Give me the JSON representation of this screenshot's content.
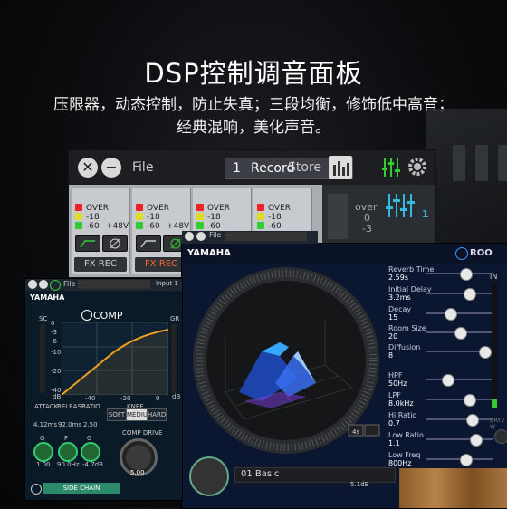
{
  "headline": {
    "title": "DSP控制调音面板",
    "line1": "压限器，动态控制，防止失真；三段均衡，修饰低中高音；",
    "line2": "经典混响，美化声音。"
  },
  "main_window": {
    "file_label": "File",
    "preset_number": "1",
    "preset_name": "Record",
    "store_label": "Store",
    "channels": [
      {
        "over": "OVER",
        "l1": "-18",
        "l2": "-60",
        "phantom": "+48V",
        "fx": "FX REC",
        "fx_active": false
      },
      {
        "over": "OVER",
        "l1": "-18",
        "l2": "-60",
        "phantom": "+48V",
        "fx": "FX REC",
        "fx_active": true
      },
      {
        "over": "OVER",
        "l1": "-18",
        "l2": "-60"
      },
      {
        "over": "OVER",
        "l1": "-18",
        "l2": "-60"
      }
    ],
    "output": {
      "over": "over",
      "zero": "0",
      "minus": "-3",
      "one": "1"
    }
  },
  "reverb_window": {
    "logo": "YAMAHA",
    "brand": "ROO",
    "small_file": "File",
    "small_preset": "---",
    "time_readout": "4s",
    "in_label": "IN",
    "dry_label": "DRY / W",
    "params": [
      {
        "label": "Reverb Time",
        "value": "2.59s",
        "pos": 0.55
      },
      {
        "label": "Initial Delay",
        "value": "3.2ms",
        "pos": 0.6
      },
      {
        "label": "Decay",
        "value": "15",
        "pos": 0.3
      },
      {
        "label": "Room Size",
        "value": "20",
        "pos": 0.45
      },
      {
        "label": "Diffusion",
        "value": "8",
        "pos": 0.85
      },
      {
        "label": "HPF",
        "value": "50Hz",
        "pos": 0.25
      },
      {
        "label": "LPF",
        "value": "8.0kHz",
        "pos": 0.6
      },
      {
        "label": "Hi Ratio",
        "value": "0.7",
        "pos": 0.65
      },
      {
        "label": "Low Ratio",
        "value": "1.1",
        "pos": 0.7
      },
      {
        "label": "Low Freq",
        "value": "800Hz",
        "pos": 0.55
      }
    ],
    "bottom_preset": "01 Basic",
    "small_value": "5.1dB"
  },
  "comp_window": {
    "file_label": "File",
    "preset": "---",
    "input": "Input 1",
    "logo": "YAMAHA",
    "title": "COMP",
    "sc_label": "SC",
    "gr_label": "GR",
    "y_ticks": [
      "0",
      "-3",
      "-6",
      "-10",
      "-20",
      "-40"
    ],
    "x_ticks": [
      "-40",
      "-20",
      "0"
    ],
    "db_label": "dB",
    "attack_label": "ATTACK",
    "attack_value": "4.12ms",
    "release_label": "RELEASE",
    "release_value": "92.0ms",
    "ratio_label": "RATIO",
    "ratio_value": "2.50",
    "knee_label": "KNEE",
    "knee_options": [
      "SOFT",
      "MEDIUM",
      "HARD"
    ],
    "knee_selected": "MEDIUM",
    "q_label": "Q",
    "q_value": "1.00",
    "f_label": "F",
    "f_value": "90.0Hz",
    "g_label": "G",
    "g_value": "-4.7dB",
    "drive_label": "COMP DRIVE",
    "drive_value": "5.00",
    "side_chain": "SIDE CHAIN"
  }
}
